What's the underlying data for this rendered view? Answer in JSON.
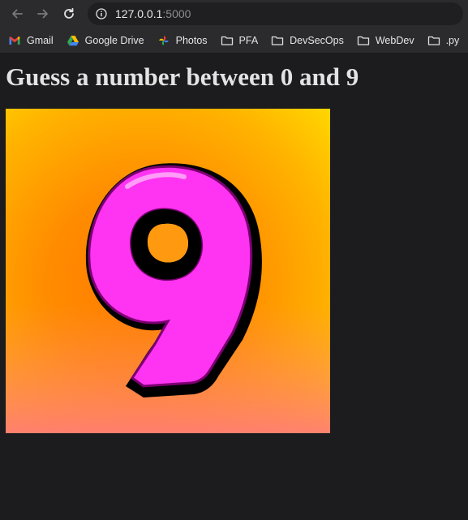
{
  "browser": {
    "url_host": "127.0.0.1",
    "url_port": ":5000",
    "bookmarks": [
      {
        "label": "Gmail",
        "icon": "gmail-icon"
      },
      {
        "label": "Google Drive",
        "icon": "google-drive-icon"
      },
      {
        "label": "Photos",
        "icon": "google-photos-icon"
      },
      {
        "label": "PFA",
        "icon": "folder-icon"
      },
      {
        "label": "DevSecOps",
        "icon": "folder-icon"
      },
      {
        "label": "WebDev",
        "icon": "folder-icon"
      },
      {
        "label": ".py",
        "icon": "folder-icon"
      }
    ]
  },
  "page": {
    "title": "Guess a number between 0 and 9",
    "image": {
      "digit": "9",
      "colors": {
        "background_top": "#ffe000",
        "background_mid": "#ff8a00",
        "background_bottom": "#ff7a7a",
        "digit_fill": "#ff33f2",
        "digit_outline": "#000000"
      }
    }
  },
  "colors": {
    "page_background": "#1c1c1e",
    "title_text": "#e3e3e3"
  }
}
